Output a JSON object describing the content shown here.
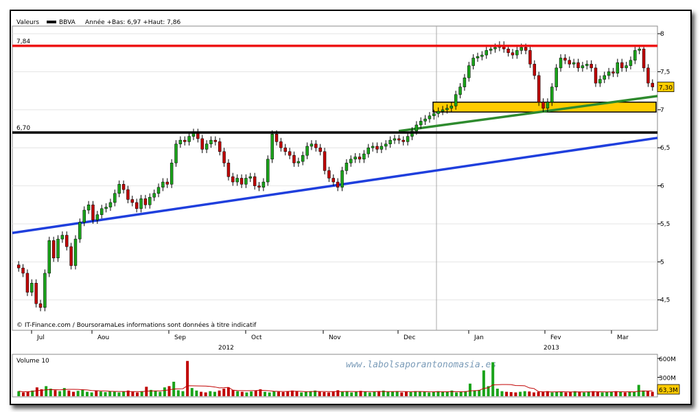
{
  "header": {
    "series_label": "Valeurs",
    "ticker": "BBVA",
    "range_text": "Année +Bas: 6,97 +Haut: 7,86"
  },
  "copyright": "© IT-Finance.com / BoursoramaLes informations sont données à titre indicatif",
  "watermark": "www.labolsaporantonomasia.es",
  "price_badge": "7,30",
  "volume_badge": "63,3M",
  "volume_title": "Volume 10",
  "colors": {
    "up": "#1aa31a",
    "down": "#c00000",
    "red_line": "#ee1111",
    "support": "#000000",
    "blue_trend": "#1f3fdd",
    "green_trend": "#2e8b2e",
    "zone": "#ffcc00"
  },
  "chart_data": [
    {
      "type": "candlestick",
      "title": "",
      "ylim": [
        4.1,
        8.1
      ],
      "y_ticks": [
        "8",
        "7,5",
        "7",
        "6,5",
        "6",
        "5,5",
        "5",
        "4,5"
      ],
      "y_tick_values": [
        8,
        7.5,
        7,
        6.5,
        6,
        5.5,
        5,
        4.5
      ],
      "x_month_labels": [
        "Jul",
        "Aou",
        "Sep",
        "Oct",
        "Nov",
        "Dec",
        "Jan",
        "Fev",
        "Mar"
      ],
      "x_year_labels": [
        "2012",
        "2013"
      ],
      "horizontal_levels": [
        {
          "label": "7,84",
          "value": 7.84,
          "color": "red"
        },
        {
          "label": "6,70",
          "value": 6.7,
          "color": "black"
        }
      ],
      "trendlines": [
        {
          "name": "blue",
          "start": 5.38,
          "end": 6.63
        },
        {
          "name": "green",
          "start": 6.72,
          "end": 7.18
        }
      ],
      "zone": {
        "low": 6.97,
        "high": 7.1
      },
      "last_price": 7.3,
      "closes": [
        4.92,
        4.85,
        4.6,
        4.72,
        4.45,
        4.4,
        4.85,
        5.28,
        5.05,
        5.3,
        5.35,
        5.2,
        4.95,
        5.3,
        5.52,
        5.68,
        5.75,
        5.55,
        5.62,
        5.7,
        5.72,
        5.78,
        5.9,
        6.02,
        5.95,
        5.82,
        5.78,
        5.7,
        5.83,
        5.75,
        5.85,
        5.9,
        5.98,
        6.05,
        6.02,
        6.3,
        6.55,
        6.6,
        6.58,
        6.65,
        6.7,
        6.62,
        6.48,
        6.55,
        6.6,
        6.58,
        6.45,
        6.3,
        6.12,
        6.05,
        6.1,
        6.02,
        6.1,
        6.12,
        6.0,
        5.98,
        6.05,
        6.35,
        6.68,
        6.58,
        6.5,
        6.45,
        6.4,
        6.3,
        6.32,
        6.4,
        6.52,
        6.55,
        6.5,
        6.45,
        6.2,
        6.1,
        6.05,
        5.98,
        6.2,
        6.3,
        6.35,
        6.38,
        6.35,
        6.42,
        6.5,
        6.52,
        6.48,
        6.52,
        6.55,
        6.6,
        6.62,
        6.6,
        6.58,
        6.65,
        6.72,
        6.8,
        6.85,
        6.88,
        6.92,
        6.95,
        6.98,
        7.0,
        7.02,
        7.05,
        7.2,
        7.3,
        7.42,
        7.58,
        7.68,
        7.7,
        7.72,
        7.78,
        7.8,
        7.82,
        7.85,
        7.8,
        7.75,
        7.72,
        7.78,
        7.82,
        7.78,
        7.6,
        7.45,
        7.1,
        7.02,
        7.1,
        7.3,
        7.55,
        7.68,
        7.65,
        7.6,
        7.62,
        7.55,
        7.58,
        7.6,
        7.55,
        7.35,
        7.4,
        7.45,
        7.5,
        7.48,
        7.62,
        7.55,
        7.58,
        7.65,
        7.78,
        7.8,
        7.55,
        7.35,
        7.3
      ],
      "volume_ylim": [
        0,
        600
      ],
      "volume_ticks": [
        "600M",
        "300M"
      ],
      "volumes": [
        80,
        60,
        75,
        90,
        140,
        110,
        160,
        120,
        95,
        80,
        130,
        90,
        70,
        85,
        100,
        70,
        60,
        90,
        75,
        65,
        80,
        70,
        60,
        75,
        90,
        70,
        60,
        80,
        150,
        100,
        85,
        70,
        140,
        160,
        230,
        95,
        80,
        560,
        130,
        90,
        70,
        60,
        80,
        70,
        90,
        120,
        140,
        100,
        80,
        70,
        60,
        75,
        90,
        110,
        70,
        60,
        80,
        70,
        65,
        80,
        90,
        75,
        60,
        70,
        80,
        90,
        70,
        65,
        60,
        75,
        95,
        70,
        80,
        60,
        70,
        85,
        75,
        60,
        70,
        80,
        90,
        70,
        75,
        80,
        60,
        70,
        65,
        80,
        75,
        70,
        60,
        65,
        80,
        75,
        70,
        90,
        60,
        70,
        80,
        200,
        90,
        100,
        410,
        160,
        540,
        120,
        80,
        70,
        65,
        60,
        70,
        80,
        75,
        60,
        70,
        65,
        80,
        60,
        70,
        75,
        60,
        65,
        80,
        70,
        60,
        75,
        80,
        70,
        60,
        65,
        70,
        80,
        75,
        60,
        70,
        65,
        180,
        90,
        80,
        70
      ]
    }
  ]
}
